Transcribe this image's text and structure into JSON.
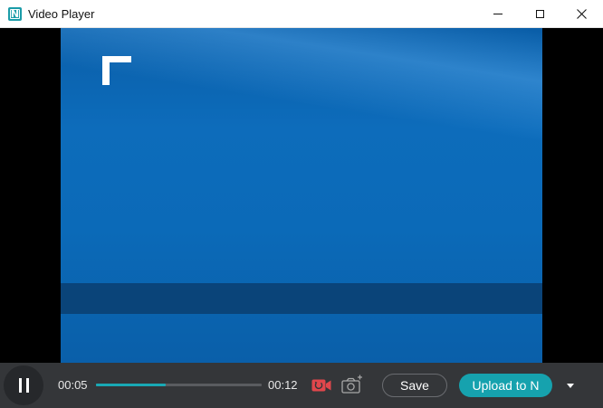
{
  "window": {
    "title": "Video Player",
    "app_icon_letter": "N",
    "icons": {
      "minimize": "minimize-icon",
      "maximize": "maximize-icon",
      "close": "close-icon"
    }
  },
  "video": {
    "overlay_icon": "corner-bracket-icon"
  },
  "controls": {
    "current_time": "00:05",
    "total_time": "00:12",
    "progress_fraction": 0.42,
    "save_label": "Save",
    "upload_label": "Upload to N",
    "icons": {
      "play_pause": "pause-icon",
      "record": "record-video-icon",
      "snapshot": "camera-icon",
      "dropdown": "chevron-down-icon"
    },
    "colors": {
      "accent": "#16a2ae",
      "record": "#e0474c",
      "bar_bg": "#343639"
    }
  }
}
